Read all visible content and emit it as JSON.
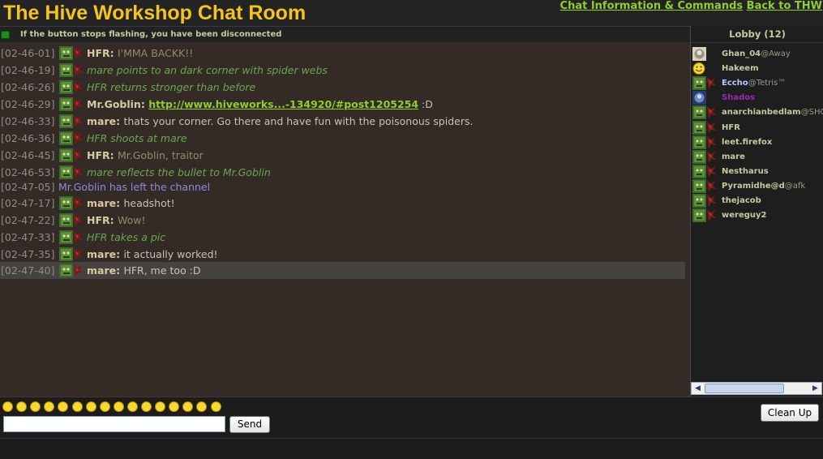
{
  "header": {
    "title": "The Hive Workshop Chat Room",
    "link_info": "Chat Information & Commands",
    "link_back": "Back to THW"
  },
  "status": {
    "text": "If the button stops flashing, you have been disconnected",
    "light_color": "#1e8c1e"
  },
  "colors": {
    "title": "#f4c41c",
    "link": "#8fce2c",
    "chat_bg": "#342a26",
    "action": "#6aa84f",
    "system": "#8c8cdc"
  },
  "messages": [
    {
      "time": "[02-46-01]",
      "kind": "message",
      "user": "HFR:",
      "text": "I'MMA BACKK!!",
      "style": "hfr"
    },
    {
      "time": "[02-46-19]",
      "kind": "action",
      "text": "mare points to an dark corner with spider webs"
    },
    {
      "time": "[02-46-26]",
      "kind": "action",
      "text": "HFR returns stronger than before"
    },
    {
      "time": "[02-46-29]",
      "kind": "link",
      "user": "Mr.Goblin:",
      "link": "http://www.hiveworks...-134920/#post1205254",
      "suffix": ":D"
    },
    {
      "time": "[02-46-33]",
      "kind": "message",
      "user": "mare:",
      "text": "thats your corner. Go there and have fun with the poisonous spiders.",
      "style": "normal"
    },
    {
      "time": "[02-46-36]",
      "kind": "action",
      "text": "HFR shoots at mare"
    },
    {
      "time": "[02-46-45]",
      "kind": "message",
      "user": "HFR:",
      "text": "Mr.Goblin, traitor",
      "style": "hfr"
    },
    {
      "time": "[02-46-53]",
      "kind": "action",
      "text": "mare reflects the bullet to Mr.Goblin"
    },
    {
      "time": "[02-47-05]",
      "kind": "system",
      "text": "Mr.Goblin has left the channel"
    },
    {
      "time": "[02-47-17]",
      "kind": "message",
      "user": "mare:",
      "text": "headshot!",
      "style": "normal"
    },
    {
      "time": "[02-47-22]",
      "kind": "message",
      "user": "HFR:",
      "text": "Wow!",
      "style": "hfr"
    },
    {
      "time": "[02-47-33]",
      "kind": "action",
      "text": "HFR takes a pic"
    },
    {
      "time": "[02-47-35]",
      "kind": "message",
      "user": "mare:",
      "text": "it actually worked!",
      "style": "normal"
    },
    {
      "time": "[02-47-40]",
      "kind": "message",
      "user": "mare:",
      "text": "HFR, me too :D",
      "style": "normal",
      "highlight": true
    }
  ],
  "lobby": {
    "title": "Lobby (12)",
    "users": [
      {
        "name": "Ghan_04",
        "status": "@Away",
        "icon": "custom-avatar-icon",
        "color": "#c8c8a0"
      },
      {
        "name": "Hakeem",
        "status": "",
        "icon": "smiley-icon",
        "color": "#c8c8a0"
      },
      {
        "name": "Eccho",
        "status": "@Tetris™",
        "icon": "orc-avatar-icon",
        "color": "#b8c8ff"
      },
      {
        "name": "Shados",
        "status": "",
        "icon": "blue-avatar-icon",
        "color": "#9a2ab0"
      },
      {
        "name": "anarchianbedlam",
        "status": "@SHOWER",
        "icon": "orc-avatar-icon",
        "color": "#c8c8a0"
      },
      {
        "name": "HFR",
        "status": "",
        "icon": "orc-avatar-icon",
        "color": "#c8c8a0"
      },
      {
        "name": "leet.firefox",
        "status": "",
        "icon": "orc-avatar-icon",
        "color": "#c8c8a0"
      },
      {
        "name": "mare",
        "status": "",
        "icon": "orc-avatar-icon",
        "color": "#c8c8a0"
      },
      {
        "name": "Nestharus",
        "status": "",
        "icon": "orc-avatar-icon",
        "color": "#c8c8a0"
      },
      {
        "name": "Pyramidhe@d",
        "status": "@afk",
        "icon": "orc-avatar-icon",
        "color": "#c8c8a0"
      },
      {
        "name": "thejacob",
        "status": "",
        "icon": "orc-avatar-icon",
        "color": "#c8c8a0"
      },
      {
        "name": "wereguy2",
        "status": "",
        "icon": "orc-avatar-icon",
        "color": "#c8c8a0"
      }
    ],
    "scroll_left": "◀",
    "scroll_right": "▶"
  },
  "composer": {
    "input_value": "",
    "send_label": "Send",
    "cleanup_label": "Clean Up",
    "smileys": [
      "grin",
      "smile",
      "cool",
      "confused",
      "laugh",
      "angry",
      "smile",
      "surprised",
      "wink",
      "sad",
      "exclaim",
      "ohmy",
      "biggrin",
      "eek",
      "rolleyes",
      "sunglasses"
    ]
  }
}
